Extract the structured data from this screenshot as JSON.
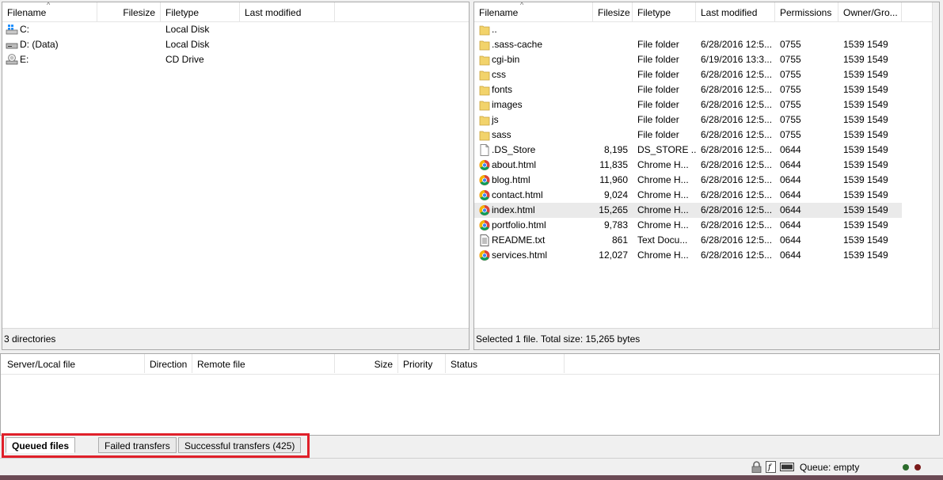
{
  "local": {
    "columns": [
      "Filename",
      "Filesize",
      "Filetype",
      "Last modified"
    ],
    "rows": [
      {
        "name": "C:",
        "size": "",
        "type": "Local Disk",
        "modified": "",
        "icon": "windows-drive-icon"
      },
      {
        "name": "D: (Data)",
        "size": "",
        "type": "Local Disk",
        "modified": "",
        "icon": "drive-icon"
      },
      {
        "name": "E:",
        "size": "",
        "type": "CD Drive",
        "modified": "",
        "icon": "cd-drive-icon"
      }
    ],
    "status": "3 directories"
  },
  "remote": {
    "columns": [
      "Filename",
      "Filesize",
      "Filetype",
      "Last modified",
      "Permissions",
      "Owner/Gro..."
    ],
    "rows": [
      {
        "name": "..",
        "size": "",
        "type": "",
        "modified": "",
        "perm": "",
        "owner": "",
        "icon": "folder-icon"
      },
      {
        "name": ".sass-cache",
        "size": "",
        "type": "File folder",
        "modified": "6/28/2016 12:5...",
        "perm": "0755",
        "owner": "1539 1549",
        "icon": "folder-icon"
      },
      {
        "name": "cgi-bin",
        "size": "",
        "type": "File folder",
        "modified": "6/19/2016 13:3...",
        "perm": "0755",
        "owner": "1539 1549",
        "icon": "folder-icon"
      },
      {
        "name": "css",
        "size": "",
        "type": "File folder",
        "modified": "6/28/2016 12:5...",
        "perm": "0755",
        "owner": "1539 1549",
        "icon": "folder-icon"
      },
      {
        "name": "fonts",
        "size": "",
        "type": "File folder",
        "modified": "6/28/2016 12:5...",
        "perm": "0755",
        "owner": "1539 1549",
        "icon": "folder-icon"
      },
      {
        "name": "images",
        "size": "",
        "type": "File folder",
        "modified": "6/28/2016 12:5...",
        "perm": "0755",
        "owner": "1539 1549",
        "icon": "folder-icon"
      },
      {
        "name": "js",
        "size": "",
        "type": "File folder",
        "modified": "6/28/2016 12:5...",
        "perm": "0755",
        "owner": "1539 1549",
        "icon": "folder-icon"
      },
      {
        "name": "sass",
        "size": "",
        "type": "File folder",
        "modified": "6/28/2016 12:5...",
        "perm": "0755",
        "owner": "1539 1549",
        "icon": "folder-icon"
      },
      {
        "name": ".DS_Store",
        "size": "8,195",
        "type": "DS_STORE ...",
        "modified": "6/28/2016 12:5...",
        "perm": "0644",
        "owner": "1539 1549",
        "icon": "file-icon"
      },
      {
        "name": "about.html",
        "size": "11,835",
        "type": "Chrome H...",
        "modified": "6/28/2016 12:5...",
        "perm": "0644",
        "owner": "1539 1549",
        "icon": "chrome-icon"
      },
      {
        "name": "blog.html",
        "size": "11,960",
        "type": "Chrome H...",
        "modified": "6/28/2016 12:5...",
        "perm": "0644",
        "owner": "1539 1549",
        "icon": "chrome-icon"
      },
      {
        "name": "contact.html",
        "size": "9,024",
        "type": "Chrome H...",
        "modified": "6/28/2016 12:5...",
        "perm": "0644",
        "owner": "1539 1549",
        "icon": "chrome-icon"
      },
      {
        "name": "index.html",
        "size": "15,265",
        "type": "Chrome H...",
        "modified": "6/28/2016 12:5...",
        "perm": "0644",
        "owner": "1539 1549",
        "icon": "chrome-icon",
        "selected": true
      },
      {
        "name": "portfolio.html",
        "size": "9,783",
        "type": "Chrome H...",
        "modified": "6/28/2016 12:5...",
        "perm": "0644",
        "owner": "1539 1549",
        "icon": "chrome-icon"
      },
      {
        "name": "README.txt",
        "size": "861",
        "type": "Text Docu...",
        "modified": "6/28/2016 12:5...",
        "perm": "0644",
        "owner": "1539 1549",
        "icon": "text-file-icon"
      },
      {
        "name": "services.html",
        "size": "12,027",
        "type": "Chrome H...",
        "modified": "6/28/2016 12:5...",
        "perm": "0644",
        "owner": "1539 1549",
        "icon": "chrome-icon"
      }
    ],
    "status": "Selected 1 file. Total size: 15,265 bytes"
  },
  "queue": {
    "columns": [
      "Server/Local file",
      "Direction",
      "Remote file",
      "Size",
      "Priority",
      "Status"
    ]
  },
  "tabs": [
    {
      "label": "Queued files",
      "active": true
    },
    {
      "label": "Failed transfers",
      "active": false
    },
    {
      "label": "Successful transfers (425)",
      "active": false
    }
  ],
  "statusbar": {
    "queue_text": "Queue: empty",
    "icons": [
      "lock-icon",
      "filter-icon",
      "binary-mode-icon"
    ]
  },
  "colors": {
    "highlight": "#e0202a",
    "folder": "#f2d36b",
    "selected_row": "#eaeaea"
  }
}
